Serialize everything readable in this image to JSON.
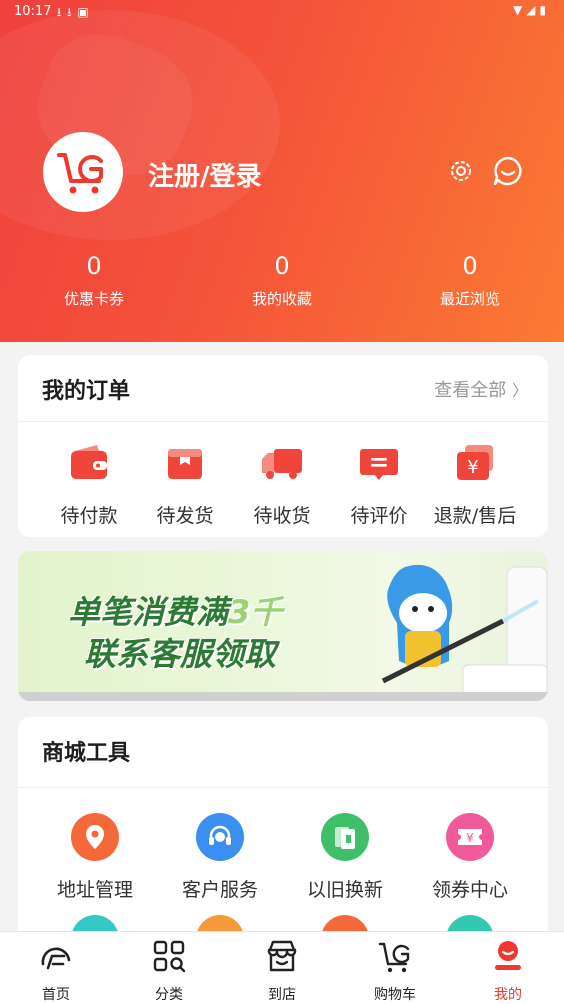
{
  "status_bar": {
    "time": "10:17"
  },
  "profile": {
    "login_label": "注册/登录"
  },
  "stats": [
    {
      "value": "0",
      "label": "优惠卡券"
    },
    {
      "value": "0",
      "label": "我的收藏"
    },
    {
      "value": "0",
      "label": "最近浏览"
    }
  ],
  "orders": {
    "title": "我的订单",
    "view_all": "查看全部",
    "items": [
      {
        "label": "待付款",
        "icon": "wallet-icon"
      },
      {
        "label": "待发货",
        "icon": "package-icon"
      },
      {
        "label": "待收货",
        "icon": "truck-icon"
      },
      {
        "label": "待评价",
        "icon": "comment-icon"
      },
      {
        "label": "退款/售后",
        "icon": "refund-icon"
      }
    ]
  },
  "banner": {
    "line1": "单笔消费满",
    "line1_highlight": "3千",
    "line2": "联系客服领取"
  },
  "tools": {
    "title": "商城工具",
    "items": [
      {
        "label": "地址管理",
        "icon": "location-icon",
        "color": "#f4683a"
      },
      {
        "label": "客户服务",
        "icon": "headset-icon",
        "color": "#3b8ff0"
      },
      {
        "label": "以旧换新",
        "icon": "exchange-icon",
        "color": "#3fbf6a"
      },
      {
        "label": "领券中心",
        "icon": "coupon-icon",
        "color": "#f05a9a"
      }
    ]
  },
  "tabbar": [
    {
      "label": "首页",
      "icon": "home-icon"
    },
    {
      "label": "分类",
      "icon": "category-icon"
    },
    {
      "label": "到店",
      "icon": "store-icon"
    },
    {
      "label": "购物车",
      "icon": "cart-icon"
    },
    {
      "label": "我的",
      "icon": "profile-icon",
      "active": true
    }
  ],
  "colors": {
    "accent": "#f0382e",
    "header_start": "#f0403d",
    "header_end": "#fb7a33"
  }
}
